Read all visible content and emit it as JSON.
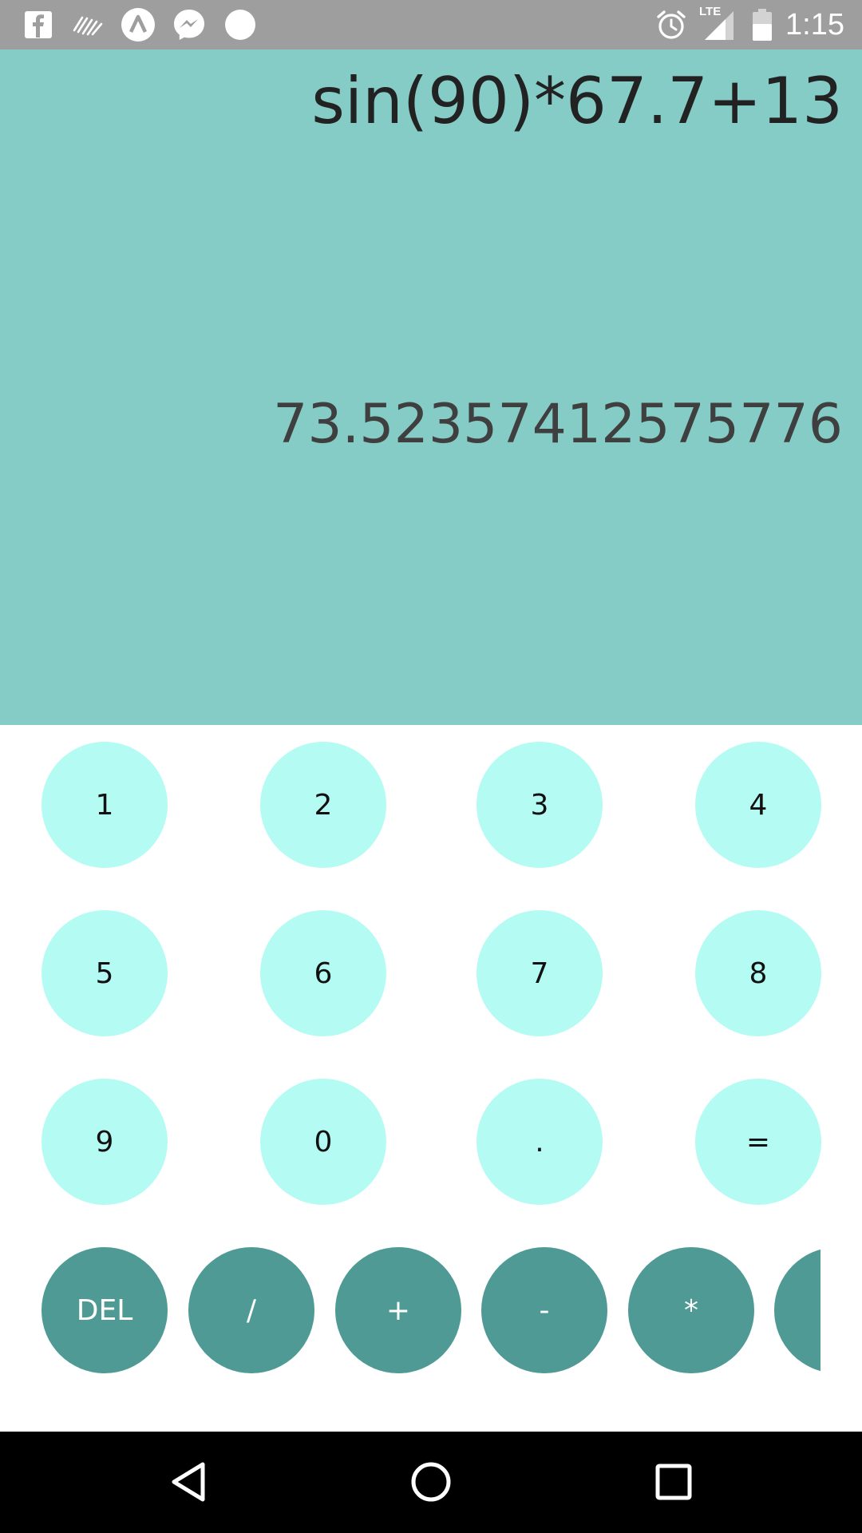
{
  "status_bar": {
    "time": "1:15",
    "network_label": "LTE",
    "left_icons": [
      "facebook-icon",
      "signal-app-icon",
      "lambda-app-icon",
      "messenger-icon",
      "dot-notification-icon"
    ],
    "right_icons": [
      "alarm-icon",
      "cell-signal-icon",
      "battery-icon"
    ]
  },
  "display": {
    "expression": "sin(90)*67.7+13",
    "result": "73.52357412575776",
    "background": "#84ccc5"
  },
  "keypad": {
    "number_keys": [
      "1",
      "2",
      "3",
      "4",
      "5",
      "6",
      "7",
      "8",
      "9",
      "0",
      ".",
      "="
    ],
    "operator_keys": [
      "DEL",
      "/",
      "+",
      "-",
      "*"
    ],
    "number_key_color": "#b4fbf4",
    "operator_key_color": "#4f9a95"
  },
  "nav_bar": {
    "buttons": [
      "back-icon",
      "home-icon",
      "recents-icon"
    ]
  }
}
